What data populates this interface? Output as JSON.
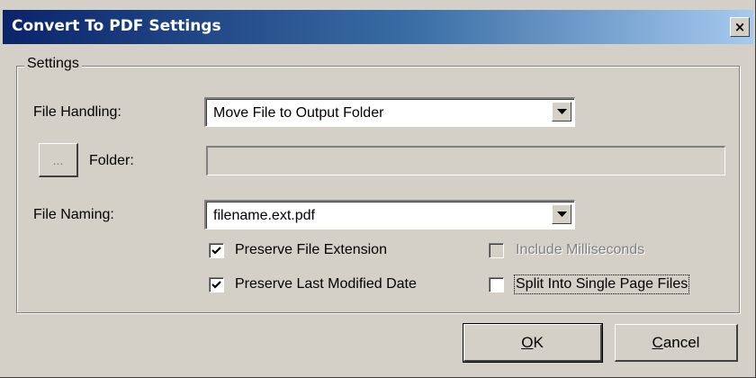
{
  "window": {
    "title": "Convert To PDF Settings",
    "close_glyph": "×"
  },
  "settings_group": {
    "title": "Settings",
    "file_handling": {
      "label": "File Handling:",
      "value": "Move File to Output Folder"
    },
    "folder": {
      "browse_label": "...",
      "label": "Folder:",
      "value": ""
    },
    "file_naming": {
      "label": "File Naming:",
      "value": "filename.ext.pdf"
    },
    "checkboxes": {
      "preserve_extension": {
        "label": "Preserve File Extension",
        "checked": true,
        "enabled": true
      },
      "include_ms": {
        "label": "Include Milliseconds",
        "checked": false,
        "enabled": false
      },
      "preserve_date": {
        "label": "Preserve Last Modified Date",
        "checked": true,
        "enabled": true
      },
      "split_pages": {
        "label": "Split Into Single Page Files",
        "checked": false,
        "enabled": true
      }
    }
  },
  "buttons": {
    "ok": {
      "accel": "O",
      "rest": "K"
    },
    "cancel": {
      "accel": "C",
      "rest": "ancel"
    }
  },
  "icons": {
    "close": "close-icon",
    "dropdown": "chevron-down-icon",
    "check": "checkmark-icon"
  }
}
